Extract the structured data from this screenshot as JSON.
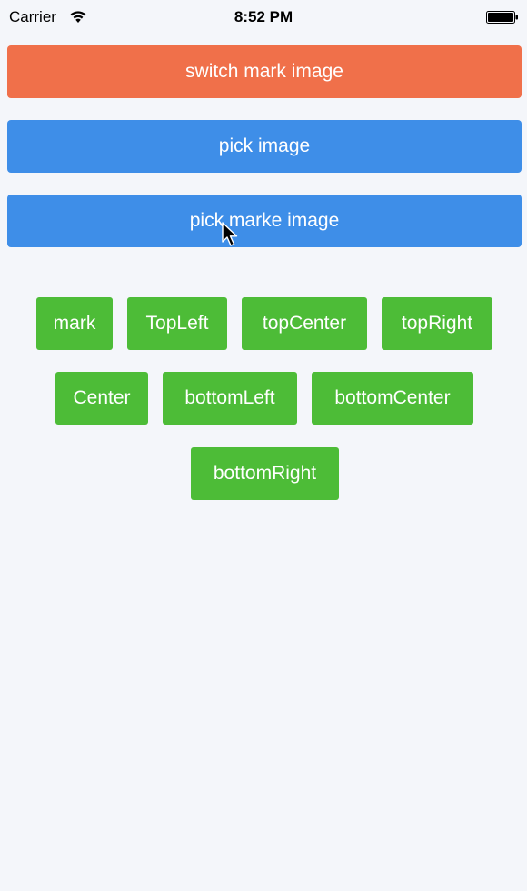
{
  "status_bar": {
    "carrier": "Carrier",
    "time": "8:52 PM",
    "wifi_icon": "wifi-icon",
    "battery_icon": "battery-icon"
  },
  "buttons": {
    "switch_mark_image": "switch mark image",
    "pick_image": "pick image",
    "pick_marke_image": "pick marke image"
  },
  "positions": {
    "mark": "mark",
    "top_left": "TopLeft",
    "top_center": "topCenter",
    "top_right": "topRight",
    "center": "Center",
    "bottom_left": "bottomLeft",
    "bottom_center": "bottomCenter",
    "bottom_right": "bottomRight"
  },
  "colors": {
    "switch_button": "#f0704a",
    "blue_button": "#3e8ee8",
    "green_button": "#4dbc37",
    "background": "#f4f6fa"
  },
  "cursor_icon": "mouse-pointer-icon"
}
